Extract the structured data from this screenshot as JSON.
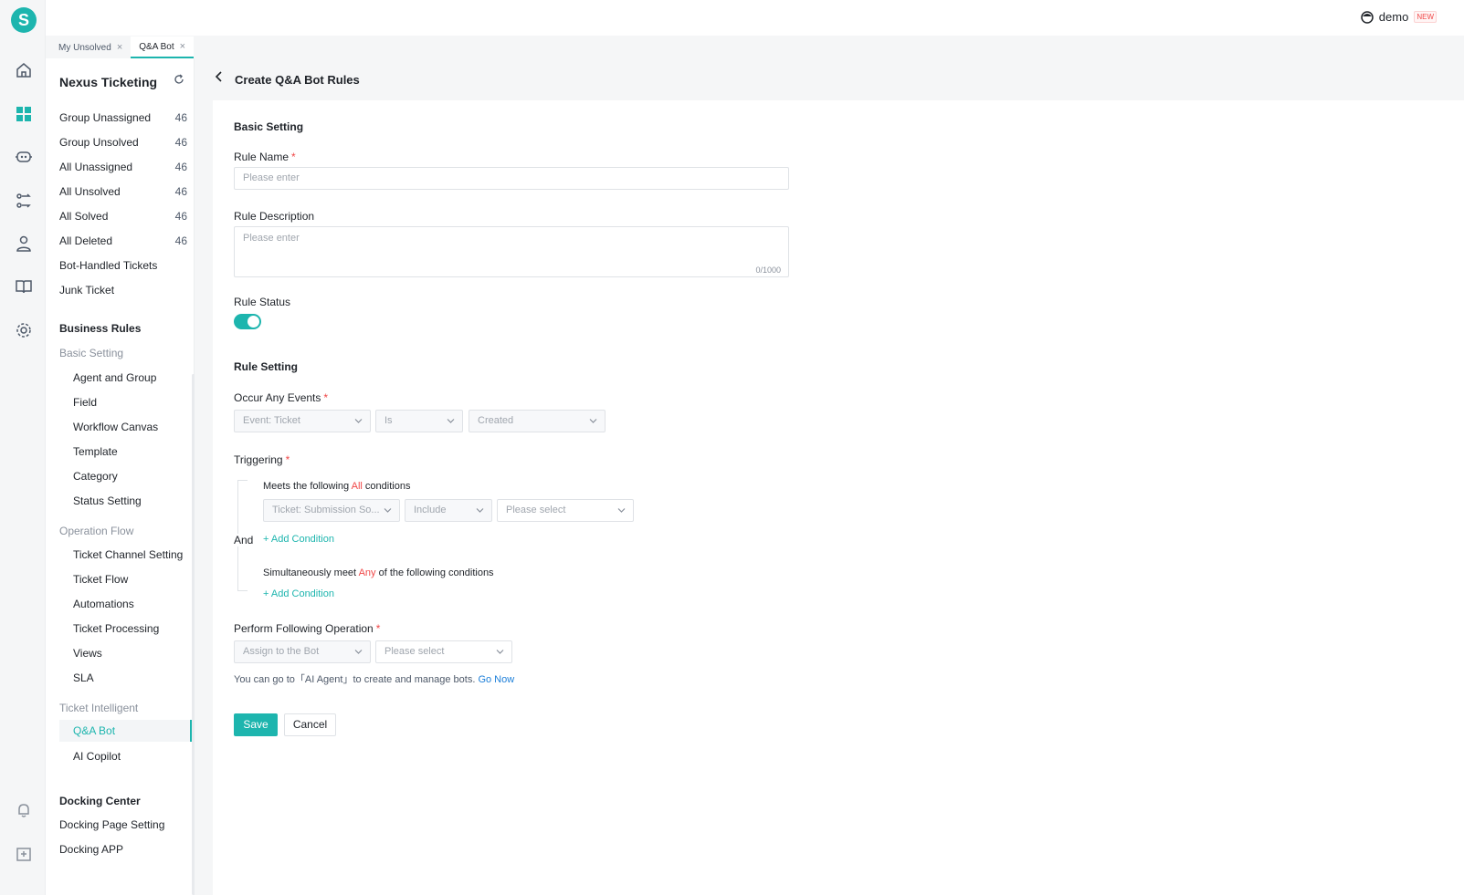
{
  "app": {
    "logo_letter": "S"
  },
  "rail": {
    "icons": [
      "home-icon",
      "dashboard-icon",
      "bot-icon",
      "flow-icon",
      "user-icon",
      "book-icon",
      "gear-icon",
      "bell-icon",
      "import-icon"
    ]
  },
  "topbar": {
    "username": "demo",
    "new_badge": "NEW"
  },
  "tabs": [
    {
      "label": "My Unsolved",
      "close": "×"
    },
    {
      "label": "Q&A Bot",
      "close": "×"
    }
  ],
  "sidebar": {
    "title": "Nexus Ticketing",
    "views": [
      {
        "label": "Group Unassigned",
        "count": "46"
      },
      {
        "label": "Group Unsolved",
        "count": "46"
      },
      {
        "label": "All Unassigned",
        "count": "46"
      },
      {
        "label": "All Unsolved",
        "count": "46"
      },
      {
        "label": "All Solved",
        "count": "46"
      },
      {
        "label": "All Deleted",
        "count": "46"
      },
      {
        "label": "Bot-Handled Tickets",
        "count": ""
      },
      {
        "label": "Junk Ticket",
        "count": ""
      }
    ],
    "business_rules": "Business Rules",
    "basic_setting": "Basic Setting",
    "basic_items": [
      "Agent and Group",
      "Field",
      "Workflow Canvas",
      "Template",
      "Category",
      "Status Setting"
    ],
    "operation_flow": "Operation Flow",
    "flow_items": [
      "Ticket Channel Setting",
      "Ticket Flow",
      "Automations",
      "Ticket Processing",
      "Views",
      "SLA"
    ],
    "ticket_intelligent": "Ticket Intelligent",
    "intelligent_items": [
      "Q&A Bot",
      "AI Copilot"
    ],
    "docking_center": "Docking Center",
    "docking_items": [
      "Docking Page Setting",
      "Docking APP"
    ]
  },
  "page": {
    "title": "Create Q&A Bot Rules"
  },
  "form": {
    "basic_setting": "Basic Setting",
    "rule_name": {
      "label": "Rule Name",
      "placeholder": "Please enter"
    },
    "rule_description": {
      "label": "Rule Description",
      "placeholder": "Please enter",
      "counter": "0/1000"
    },
    "rule_status": {
      "label": "Rule Status",
      "enabled": true
    },
    "rule_setting": "Rule Setting",
    "occur_events": {
      "label": "Occur Any Events",
      "event": "Event: Ticket",
      "operator": "Is",
      "value": "Created"
    },
    "triggering": {
      "label": "Triggering",
      "all_prefix": "Meets the following",
      "all_word": "All",
      "all_suffix": "conditions",
      "condition": {
        "field": "Ticket: Submission So...",
        "operator": "Include",
        "value": "Please select"
      },
      "and_label": "And",
      "add_condition": "+ Add Condition",
      "any_prefix": "Simultaneously meet",
      "any_word": "Any",
      "any_suffix": "of the following conditions"
    },
    "operation": {
      "label": "Perform Following Operation",
      "action": "Assign to the Bot",
      "target": "Please select"
    },
    "hint": {
      "text": "You can go to「AI Agent」to create and manage bots.",
      "link": "Go Now"
    },
    "required_mark": "*"
  },
  "actions": {
    "save": "Save",
    "cancel": "Cancel"
  },
  "colors": {
    "accent": "#1db5ae",
    "required": "#f04848",
    "link": "#1d7fd9"
  }
}
